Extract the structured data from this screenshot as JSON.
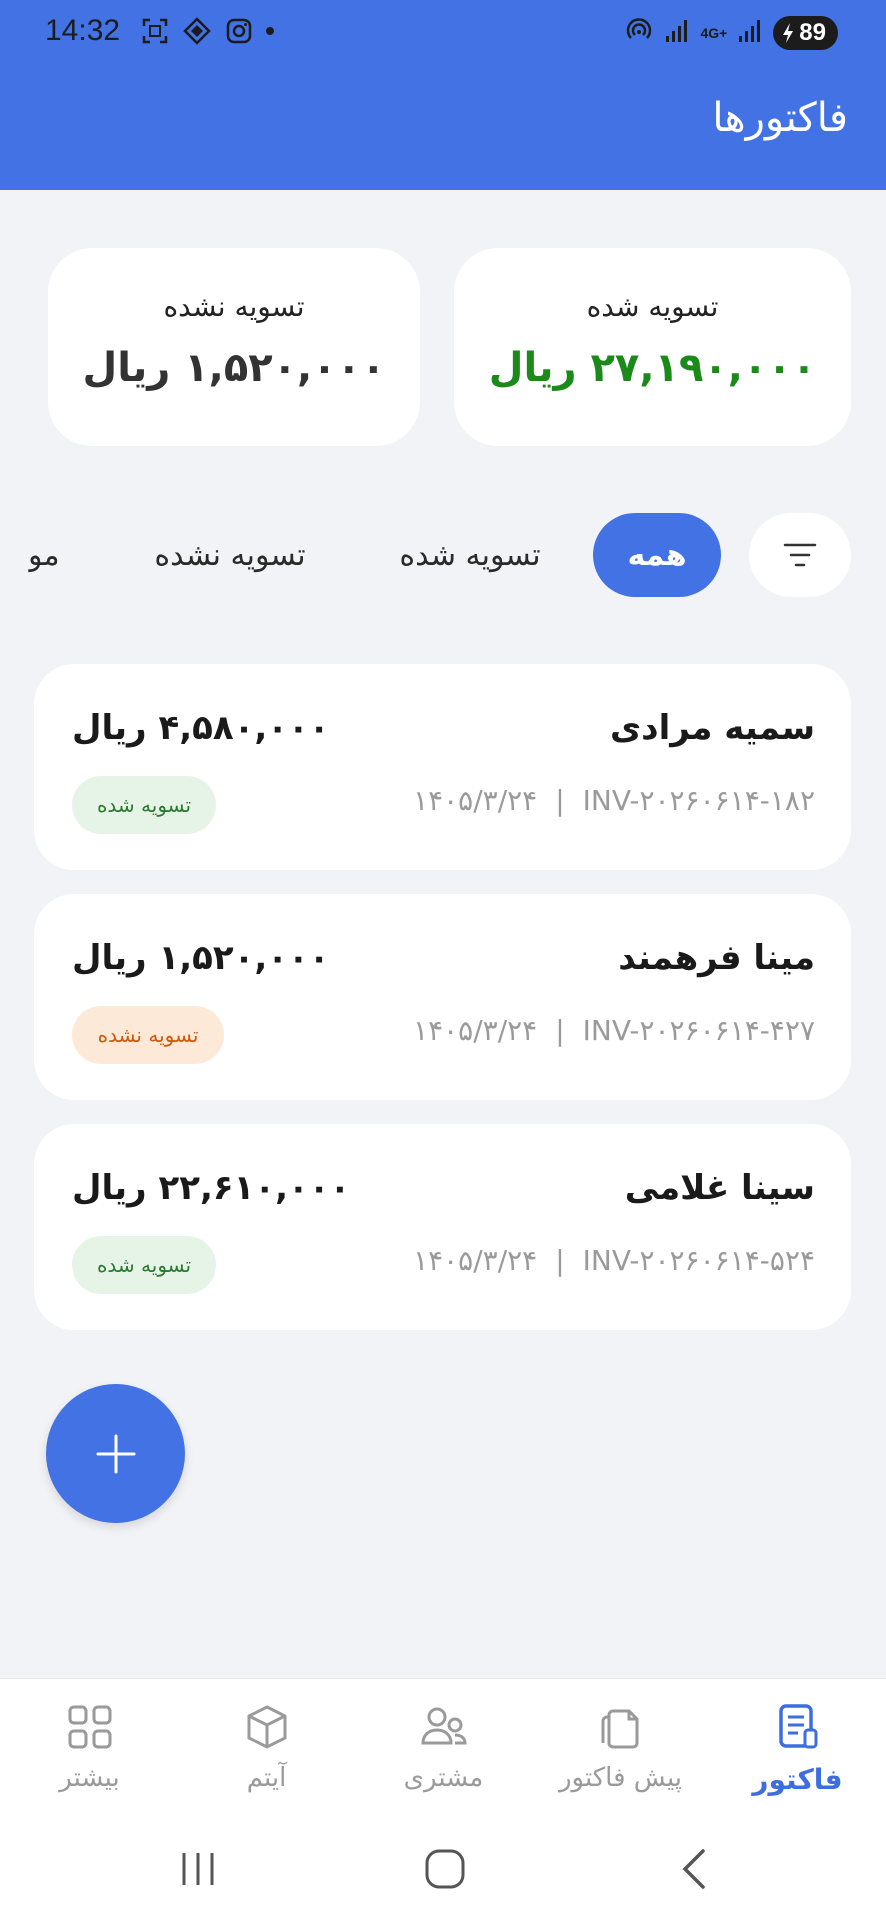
{
  "status_bar": {
    "time": "14:32",
    "battery": "89",
    "network_label": "4G+"
  },
  "header": {
    "title": "فاکتورها"
  },
  "summary": {
    "settled": {
      "label": "تسویه شده",
      "value": "۲۷,۱۹۰,۰۰۰ ریال"
    },
    "unsettled": {
      "label": "تسویه نشده",
      "value": "۱,۵۲۰,۰۰۰ ریال"
    }
  },
  "filters": {
    "all": "همه",
    "settled": "تسویه شده",
    "unsettled": "تسویه نشده",
    "more": "مو"
  },
  "invoices": [
    {
      "name": "سمیه مرادی",
      "amount": "۴,۵۸۰,۰۰۰ ریال",
      "number": "INV-۲۰۲۶۰۶۱۴-۱۸۲",
      "date": "۱۴۰۵/۳/۲۴",
      "status": "تسویه شده",
      "status_color": "#2a7a30"
    },
    {
      "name": "مینا فرهمند",
      "amount": "۱,۵۲۰,۰۰۰ ریال",
      "number": "INV-۲۰۲۶۰۶۱۴-۴۲۷",
      "date": "۱۴۰۵/۳/۲۴",
      "status": "تسویه نشده",
      "status_color": "#d0580e"
    },
    {
      "name": "سینا غلامی",
      "amount": "۲۲,۶۱۰,۰۰۰ ریال",
      "number": "INV-۲۰۲۶۰۶۱۴-۵۲۴",
      "date": "۱۴۰۵/۳/۲۴",
      "status": "تسویه شده",
      "status_color": "#2a7a30"
    }
  ],
  "separator": "|",
  "bottom_nav": [
    {
      "label": "فاکتور",
      "icon": "invoice-icon",
      "active": true
    },
    {
      "label": "پیش فاکتور",
      "icon": "copy-document-icon",
      "active": false
    },
    {
      "label": "مشتری",
      "icon": "users-icon",
      "active": false
    },
    {
      "label": "آیتم",
      "icon": "box-icon",
      "active": false
    },
    {
      "label": "بیشتر",
      "icon": "grid-icon",
      "active": false
    }
  ],
  "colors": {
    "primary": "#4272e3",
    "settled_amount": "#1b8a1b",
    "background": "#f2f3f7"
  }
}
